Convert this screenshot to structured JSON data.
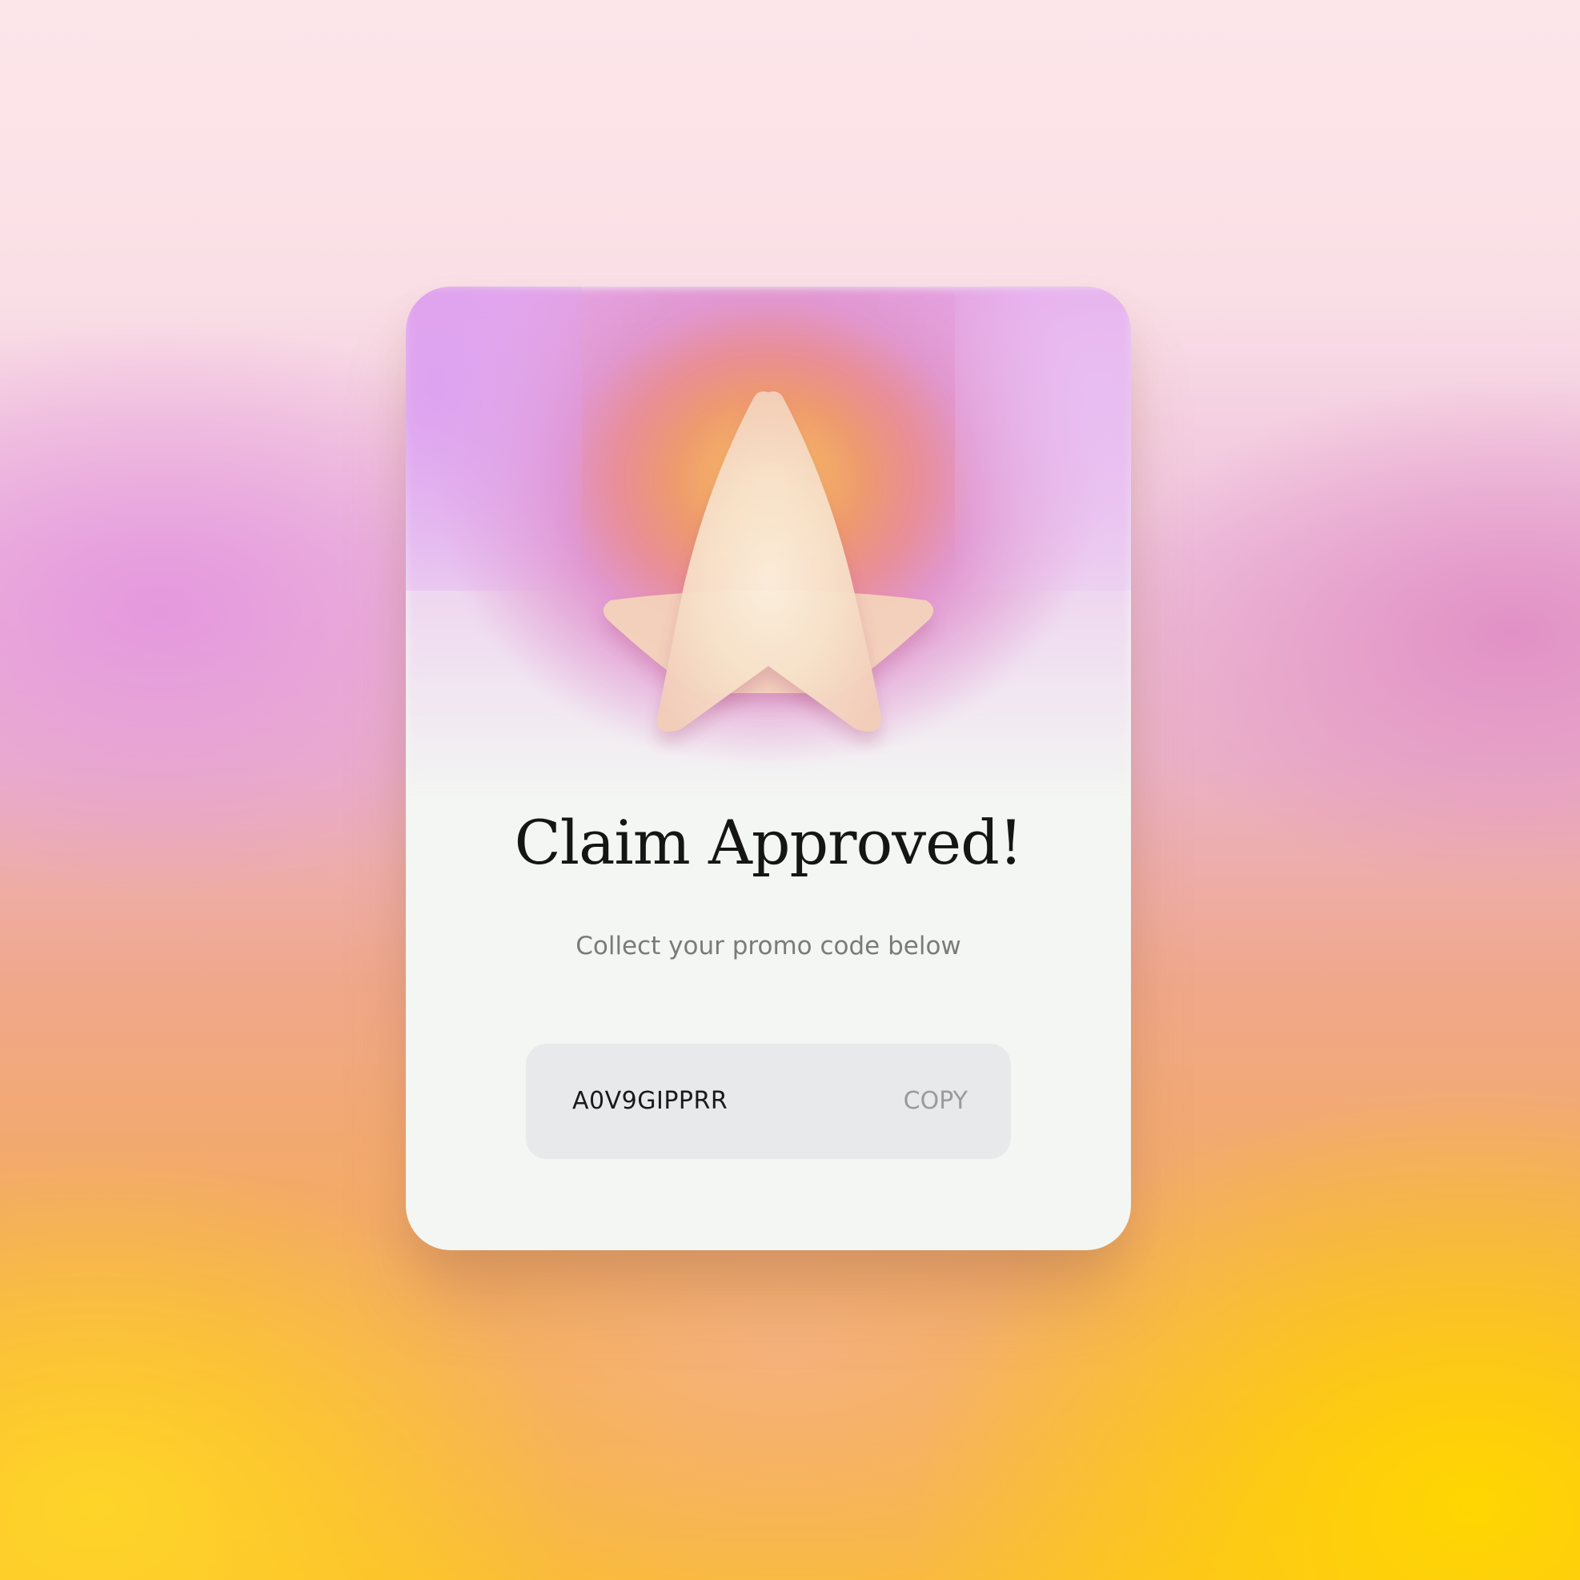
{
  "card": {
    "title": "Claim Approved!",
    "subtitle": "Collect your promo code below",
    "promo": {
      "code": "A0V9GIPPRR",
      "copy_label": "COPY"
    },
    "icon": "star-icon"
  },
  "colors": {
    "card_background": "#f4f6f3",
    "code_box_background": "#e8e9ea",
    "title_color": "#151515",
    "subtitle_color": "#7a7a7a",
    "copy_color": "#9a9a9a",
    "glow_center": "#f4b066",
    "glow_mid": "#e98e96",
    "glow_outer": "#e197cf"
  }
}
